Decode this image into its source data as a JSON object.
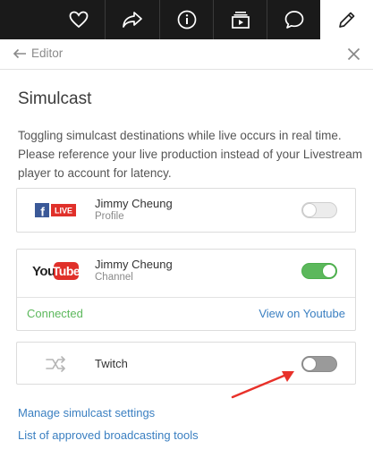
{
  "topbar": {
    "icons": [
      "heart-icon",
      "share-arrow-icon",
      "info-icon",
      "media-stack-icon",
      "chat-bubble-icon",
      "pencil-icon"
    ],
    "active": "pencil-icon"
  },
  "editor": {
    "back_label": "Editor"
  },
  "simulcast": {
    "title": "Simulcast",
    "description": "Toggling simulcast destinations while live occurs in real time. Please reference your live production instead of your Livestream player to account for latency."
  },
  "destinations": [
    {
      "logo": "facebook-live-logo",
      "logo_f": "f",
      "logo_text": "LIVE",
      "name": "Jimmy Cheung",
      "type": "Profile",
      "enabled": false
    },
    {
      "logo": "youtube-logo",
      "logo_you": "You",
      "logo_tube": "Tube",
      "name": "Jimmy Cheung",
      "type": "Channel",
      "enabled": true,
      "status": "Connected",
      "link": "View on Youtube"
    },
    {
      "logo": "twitch-placeholder-icon",
      "name": "Twitch",
      "enabled": false
    }
  ],
  "links": {
    "manage": "Manage simulcast settings",
    "approved": "List of approved broadcasting tools"
  },
  "colors": {
    "topbar": "#1a1a1a",
    "toggle_on": "#5cb85c",
    "link": "#3a7fc1",
    "annotation_arrow": "#e8312a"
  }
}
